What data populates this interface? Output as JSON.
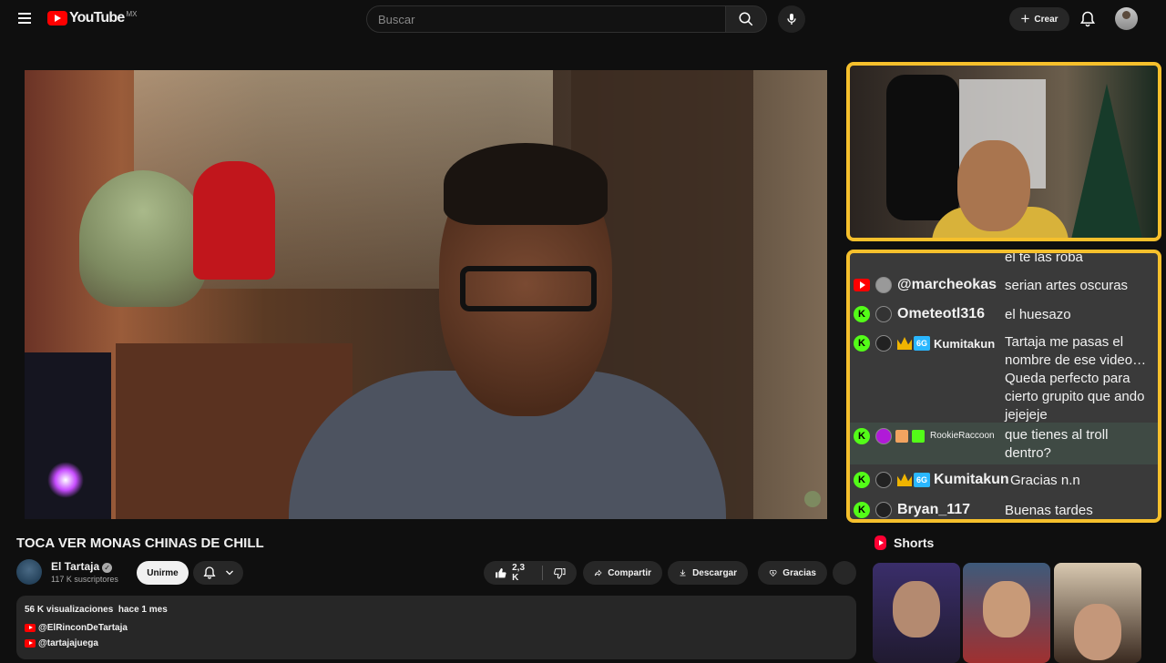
{
  "header": {
    "logo_text": "YouTube",
    "country_code": "MX",
    "search_placeholder": "Buscar",
    "create_label": "Crear"
  },
  "chat": {
    "top_partial": "el te las roba",
    "messages": [
      {
        "platform": "youtube",
        "user": "@marcheokas",
        "text": "serian artes oscuras"
      },
      {
        "platform": "kick",
        "user": "Ometeotl316",
        "text": "el huesazo"
      },
      {
        "platform": "kick",
        "user": "Kumitakun",
        "badge": "6G",
        "text": "Tartaja me pasas el\nnombre de ese video…\nQueda perfecto para\ncierto grupito que ando\njejejeje"
      },
      {
        "platform": "kick",
        "user": "RookieRaccoon",
        "text": "que tienes al troll\ndentro?"
      },
      {
        "platform": "kick",
        "user": "Kumitakun",
        "badge": "6G",
        "text": "Gracias n.n"
      },
      {
        "platform": "kick",
        "user": "Bryan_117",
        "text": "Buenas tardes"
      }
    ],
    "kick_letter": "K"
  },
  "video": {
    "title": "TOCA VER MONAS CHINAS DE CHILL",
    "channel_name": "El Tartaja",
    "subscribers": "117 K suscriptores",
    "join_label": "Unirme",
    "likes": "2,3 K",
    "share_label": "Compartir",
    "download_label": "Descargar",
    "thanks_label": "Gracias",
    "views": "56 K visualizaciones",
    "time_ago": "hace 1 mes",
    "links": [
      "@ElRinconDeTartaja",
      "@tartajajuega"
    ]
  },
  "shorts": {
    "heading": "Shorts"
  },
  "colors": {
    "accent_frame": "#f6c02c",
    "youtube_red": "#ff0000",
    "kick_green": "#53fc18"
  }
}
